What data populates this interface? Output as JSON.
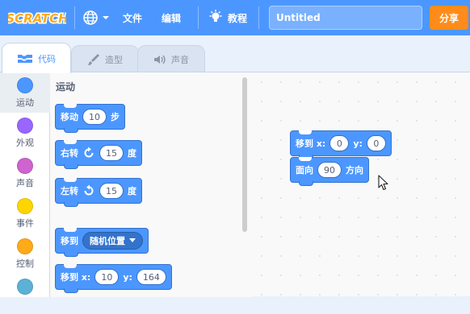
{
  "menubar": {
    "logo_text": "SCRATCH",
    "file_label": "文件",
    "edit_label": "编辑",
    "tutorials_label": "教程",
    "project_title": "Untitled",
    "share_label": "分享",
    "colors": {
      "bar": "#4c97ff",
      "share": "#ff8c1a"
    }
  },
  "tabs": [
    {
      "label": "代码",
      "icon": "code-icon",
      "active": true
    },
    {
      "label": "造型",
      "icon": "brush-icon",
      "active": false
    },
    {
      "label": "声音",
      "icon": "speaker-icon",
      "active": false
    }
  ],
  "categories": [
    {
      "label": "运动",
      "color": "#4c97ff",
      "selected": true
    },
    {
      "label": "外观",
      "color": "#9966ff"
    },
    {
      "label": "声音",
      "color": "#cf63cf"
    },
    {
      "label": "事件",
      "color": "#ffd500"
    },
    {
      "label": "控制",
      "color": "#ffab19"
    },
    {
      "label": "",
      "color": "#5cb1d6"
    }
  ],
  "palette": {
    "heading": "运动",
    "blocks": {
      "move": {
        "text": "移动",
        "steps": "10",
        "suffix": "步"
      },
      "turn_right": {
        "text": "右转",
        "degrees": "15",
        "suffix": "度"
      },
      "turn_left": {
        "text": "左转",
        "degrees": "15",
        "suffix": "度"
      },
      "goto": {
        "text": "移到",
        "target": "随机位置"
      },
      "goto_xy": {
        "text": "移到 x:",
        "x": "10",
        "y_label": "y:",
        "y": "164"
      }
    }
  },
  "workspace": {
    "goto_xy": {
      "text": "移到 x:",
      "x": "0",
      "y_label": "y:",
      "y": "0"
    },
    "point": {
      "text": "面向",
      "direction": "90",
      "suffix": "方向"
    }
  }
}
